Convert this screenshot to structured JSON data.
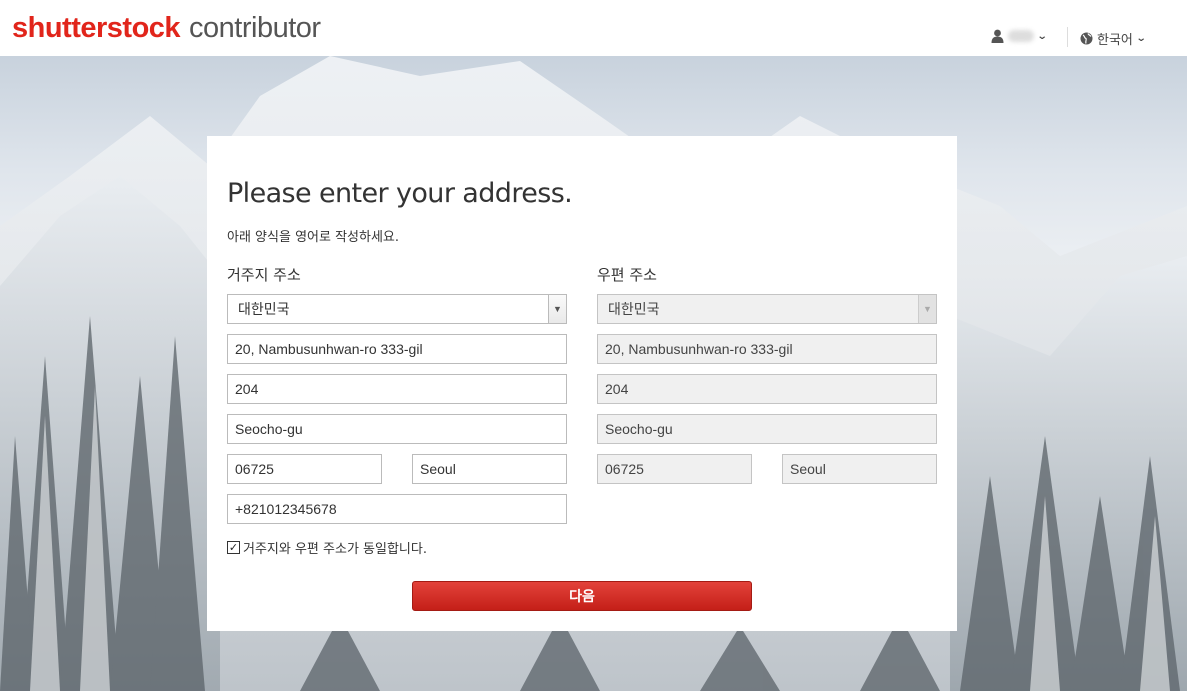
{
  "header": {
    "logo_brand": "shutterstock",
    "logo_sub": "contributor",
    "user_icon": "user-icon",
    "language_label": "한국어",
    "globe_icon": "globe-icon"
  },
  "form": {
    "title": "Please enter your address.",
    "subtitle": "아래 양식을 영어로 작성하세요.",
    "residential": {
      "label": "거주지 주소",
      "country": "대한민국",
      "address1": "20, Nambusunhwan-ro 333-gil",
      "address2": "204",
      "district": "Seocho-gu",
      "postal_code": "06725",
      "city": "Seoul",
      "phone": "+821012345678"
    },
    "mailing": {
      "label": "우편 주소",
      "country": "대한민국",
      "address1": "20, Nambusunhwan-ro 333-gil",
      "address2": "204",
      "district": "Seocho-gu",
      "postal_code": "06725",
      "city": "Seoul"
    },
    "same_address_label": "거주지와 우편 주소가 동일합니다.",
    "same_address_checked": true,
    "checkbox_mark": "☑",
    "next_button": "다음"
  },
  "colors": {
    "brand_red": "#e1251b",
    "button_red": "#d2302a"
  }
}
